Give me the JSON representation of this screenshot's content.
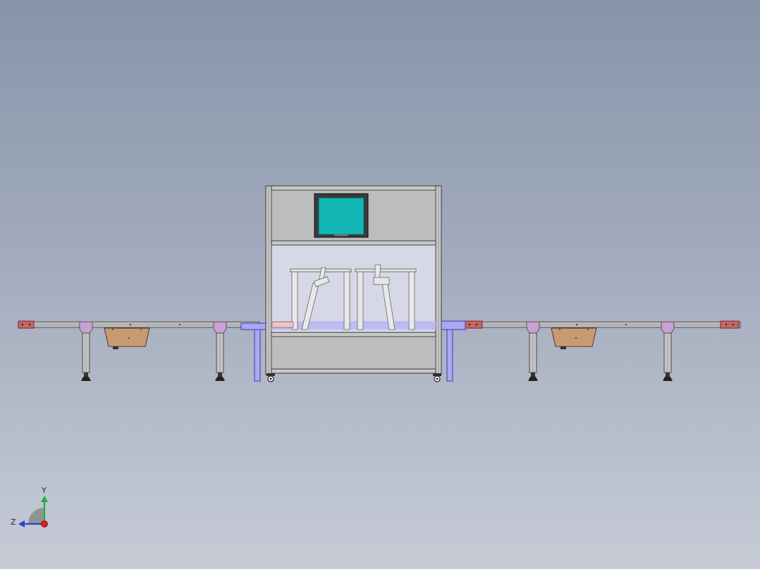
{
  "viewport": {
    "background_top": "#8795a9",
    "background_bottom": "#c6cbd6"
  },
  "triad": {
    "y_label": "Y",
    "z_label": "Z",
    "colors": {
      "y": "#22b03a",
      "z": "#2844d6",
      "x": "#e21c1c"
    }
  },
  "colors": {
    "frame": "#bdbdbd",
    "frame_dark": "#6c6c6c",
    "screen": "#12b7b5",
    "bezel": "#3a3a3a",
    "glass": "#d6d8e6",
    "blue_support": "#a9a9f2",
    "bracket": "#c8a2cf",
    "box": "#c89a72",
    "end_cap": "#c86464"
  },
  "icons": {
    "monitor": "monitor-icon",
    "triad": "coordinate-triad-icon"
  }
}
